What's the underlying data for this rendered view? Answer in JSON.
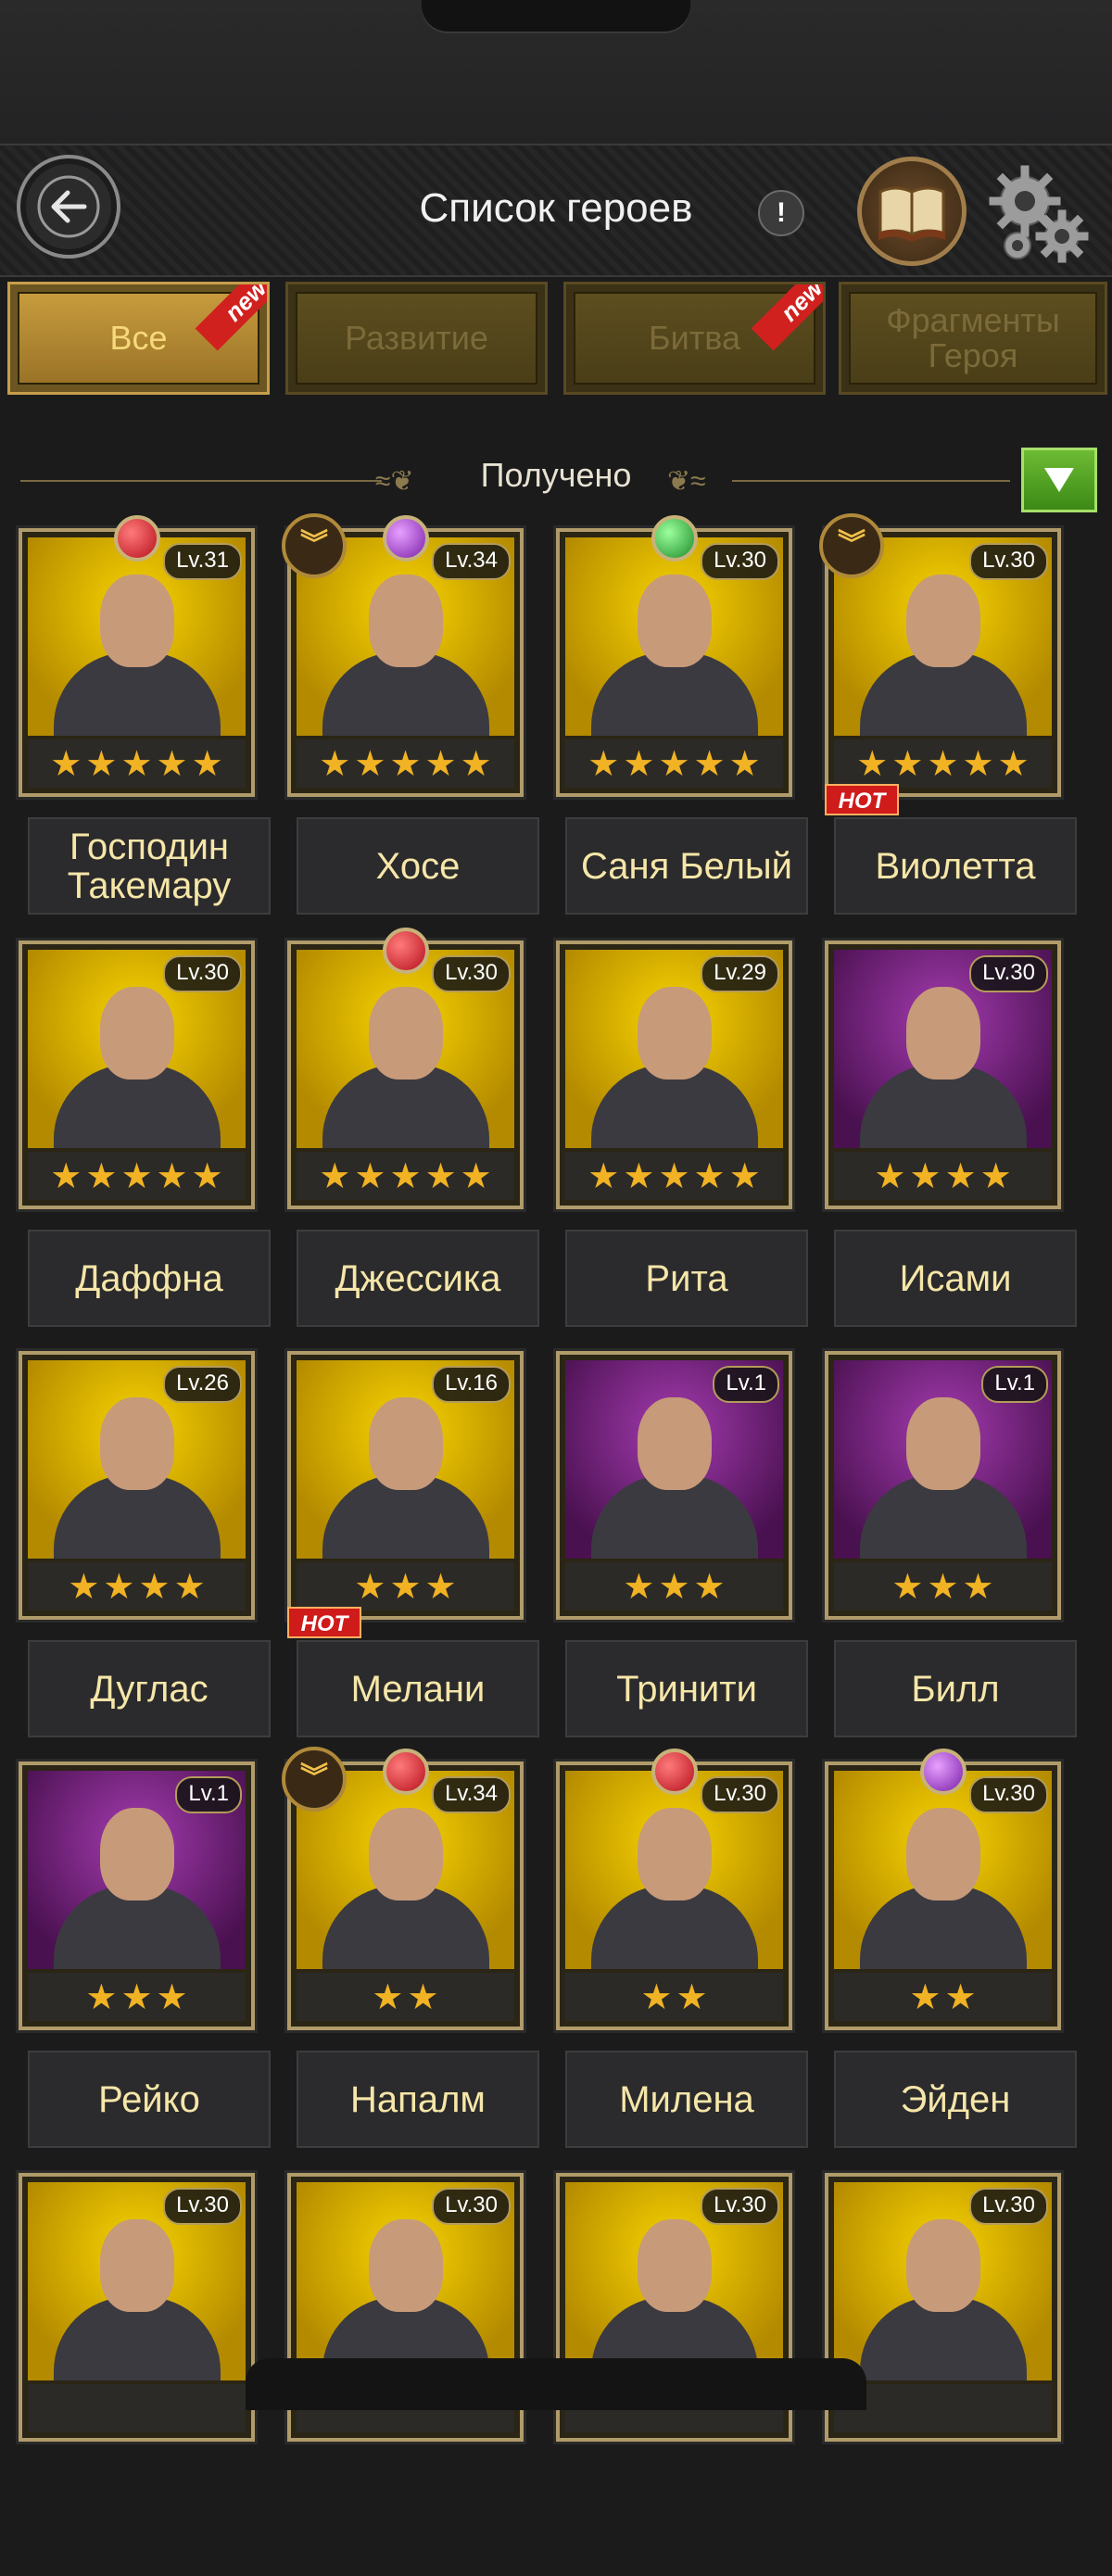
{
  "header": {
    "title": "Список героев",
    "info_symbol": "!"
  },
  "tabs": [
    {
      "label": "Все",
      "badge": "new",
      "active": true
    },
    {
      "label": "Развитие",
      "badge": "",
      "active": false
    },
    {
      "label": "Битва",
      "badge": "new",
      "active": false
    },
    {
      "label": "Фрагменты Героя",
      "badge": "",
      "active": false
    }
  ],
  "section": {
    "label": "Получено",
    "dropdown_icon": "triangle-down-icon"
  },
  "heroes": [
    {
      "name": "Господин Такемару",
      "level": "Lv.31",
      "stars": 5,
      "gem": "red",
      "rank_badge": false,
      "hot": false,
      "bg": "yellow"
    },
    {
      "name": "Хосе",
      "level": "Lv.34",
      "stars": 5,
      "gem": "purple",
      "rank_badge": true,
      "hot": false,
      "bg": "yellow"
    },
    {
      "name": "Саня Белый",
      "level": "Lv.30",
      "stars": 5,
      "gem": "green",
      "rank_badge": false,
      "hot": false,
      "bg": "yellow"
    },
    {
      "name": "Виолетта",
      "level": "Lv.30",
      "stars": 5,
      "gem": "",
      "rank_badge": true,
      "hot": true,
      "bg": "yellow"
    },
    {
      "name": "Даффна",
      "level": "Lv.30",
      "stars": 5,
      "gem": "",
      "rank_badge": false,
      "hot": false,
      "bg": "yellow"
    },
    {
      "name": "Джессика",
      "level": "Lv.30",
      "stars": 5,
      "gem": "red",
      "rank_badge": false,
      "hot": false,
      "bg": "yellow"
    },
    {
      "name": "Рита",
      "level": "Lv.29",
      "stars": 5,
      "gem": "",
      "rank_badge": false,
      "hot": false,
      "bg": "yellow"
    },
    {
      "name": "Исами",
      "level": "Lv.30",
      "stars": 4,
      "gem": "",
      "rank_badge": false,
      "hot": false,
      "bg": "purple"
    },
    {
      "name": "Дуглас",
      "level": "Lv.26",
      "stars": 4,
      "gem": "",
      "rank_badge": false,
      "hot": false,
      "bg": "yellow"
    },
    {
      "name": "Мелани",
      "level": "Lv.16",
      "stars": 3,
      "gem": "",
      "rank_badge": false,
      "hot": true,
      "bg": "yellow"
    },
    {
      "name": "Тринити",
      "level": "Lv.1",
      "stars": 3,
      "gem": "",
      "rank_badge": false,
      "hot": false,
      "bg": "purple"
    },
    {
      "name": "Билл",
      "level": "Lv.1",
      "stars": 3,
      "gem": "",
      "rank_badge": false,
      "hot": false,
      "bg": "purple"
    },
    {
      "name": "Рейко",
      "level": "Lv.1",
      "stars": 3,
      "gem": "",
      "rank_badge": false,
      "hot": false,
      "bg": "purple"
    },
    {
      "name": "Напалм",
      "level": "Lv.34",
      "stars": 2,
      "gem": "red",
      "rank_badge": true,
      "hot": false,
      "bg": "yellow"
    },
    {
      "name": "Милена",
      "level": "Lv.30",
      "stars": 2,
      "gem": "red",
      "rank_badge": false,
      "hot": false,
      "bg": "yellow"
    },
    {
      "name": "Эйден",
      "level": "Lv.30",
      "stars": 2,
      "gem": "purple",
      "rank_badge": false,
      "hot": false,
      "bg": "yellow"
    },
    {
      "name": "",
      "level": "Lv.30",
      "stars": 0,
      "gem": "",
      "rank_badge": false,
      "hot": false,
      "bg": "yellow"
    },
    {
      "name": "",
      "level": "Lv.30",
      "stars": 0,
      "gem": "",
      "rank_badge": false,
      "hot": false,
      "bg": "yellow"
    },
    {
      "name": "",
      "level": "Lv.30",
      "stars": 0,
      "gem": "",
      "rank_badge": false,
      "hot": false,
      "bg": "yellow"
    },
    {
      "name": "",
      "level": "Lv.30",
      "stars": 0,
      "gem": "",
      "rank_badge": false,
      "hot": false,
      "bg": "yellow"
    }
  ],
  "hot_label": "HOT",
  "colors": {
    "accent_gold": "#f6d97a",
    "star": "#f1b224",
    "hot_red": "#d01b1b",
    "dropdown_green": "#4fa01f"
  }
}
